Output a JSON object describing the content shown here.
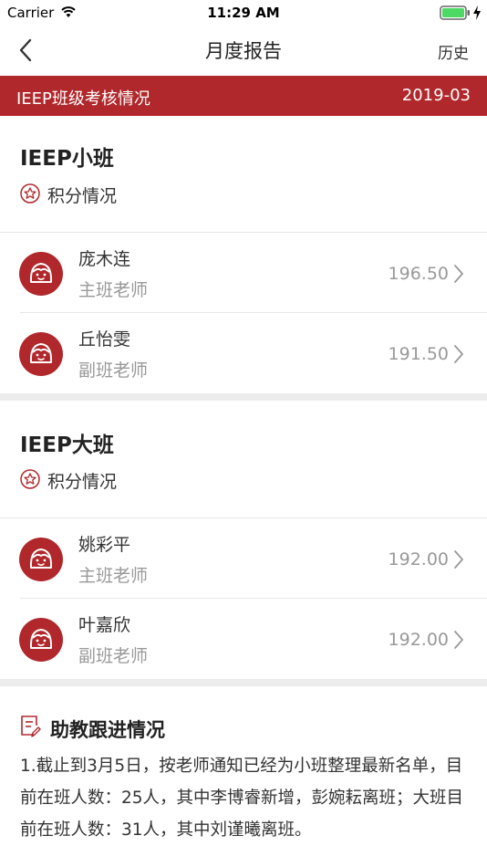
{
  "status_bar": {
    "carrier": "Carrier",
    "time": "11:29 AM"
  },
  "nav": {
    "title": "月度报告",
    "history": "历史"
  },
  "banner": {
    "title": "IEEP班级考核情况",
    "date": "2019-03"
  },
  "classes": [
    {
      "title": "IEEP小班",
      "score_label": "积分情况",
      "teachers": [
        {
          "name": "庞木连",
          "role": "主班老师",
          "score": "196.50"
        },
        {
          "name": "丘怡雯",
          "role": "副班老师",
          "score": "191.50"
        }
      ]
    },
    {
      "title": "IEEP大班",
      "score_label": "积分情况",
      "teachers": [
        {
          "name": "姚彩平",
          "role": "主班老师",
          "score": "192.00"
        },
        {
          "name": "叶嘉欣",
          "role": "副班老师",
          "score": "192.00"
        }
      ]
    }
  ],
  "follow_up": {
    "title": "助教跟进情况",
    "body": "1.截止到3月5日，按老师通知已经为小班整理最新名单，目前在班人数：25人，其中李博睿新增，彭婉耘离班；大班目前在班人数：31人，其中刘谨曦离班。"
  },
  "colors": {
    "brand": "#b0282b",
    "gap": "#ececec",
    "muted": "#999999"
  }
}
